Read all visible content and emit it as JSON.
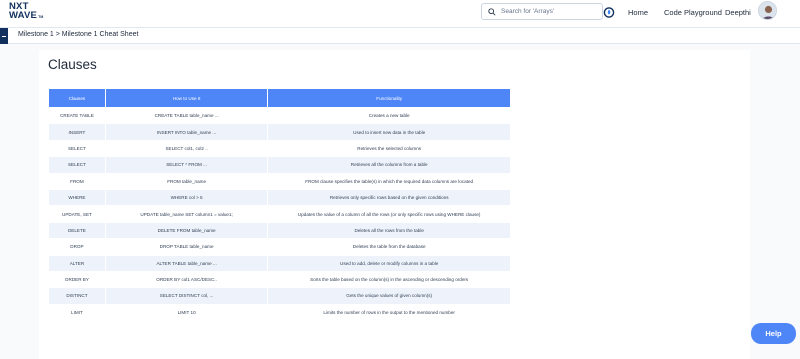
{
  "header": {
    "logo_line1": "NXT",
    "logo_line2": "WAVE",
    "logo_tm": "TM",
    "search_placeholder": "Search for 'Arrays'",
    "nav": {
      "home": "Home",
      "code_playground": "Code Playground",
      "user": "Deepthi"
    }
  },
  "breadcrumb": "Milestone 1 > Milestone 1 Cheat Sheet",
  "section_title": "Clauses",
  "table": {
    "headers": [
      "Clauses",
      "How to Use It",
      "Functionality"
    ],
    "rows": [
      [
        "CREATE TABLE",
        "CREATE TABLE table_name ...",
        "Creates a new table"
      ],
      [
        "INSERT",
        "INSERT INTO table_name ...",
        "Used to insert new data in the table"
      ],
      [
        "SELECT",
        "SELECT col1, col2 ..",
        "Retrieves the selected columns"
      ],
      [
        "SELECT",
        "SELECT * FROM ...",
        "Retrieves all the columns from a table"
      ],
      [
        "FROM",
        "FROM table_name",
        "FROM clause specifies the table(s) in which the required data columns are located"
      ],
      [
        "WHERE",
        "WHERE col > 5",
        "Retrieves only specific rows based on the given conditions"
      ],
      [
        "UPDATE, SET",
        "UPDATE table_name SET column1 = value1;",
        "Updates the value of a column of all the rows (or only specific rows using WHERE clause)"
      ],
      [
        "DELETE",
        "DELETE FROM table_name",
        "Deletes all the rows from the table"
      ],
      [
        "DROP",
        "DROP TABLE table_name",
        "Deletes the table from the database"
      ],
      [
        "ALTER",
        "ALTER TABLE table_name ...",
        "Used to add, delete or modify columns in a table"
      ],
      [
        "ORDER BY",
        "ORDER BY col1 ASC/DESC..",
        "Sorts the table based on the column(s) in the ascending or descending orders"
      ],
      [
        "DISTINCT",
        "SELECT DISTINCT col, ...",
        "Gets the unique values of given column(s)"
      ],
      [
        "LIMIT",
        "LIMIT 10",
        "Limits the number of rows in the output to the mentioned number"
      ]
    ]
  },
  "help_button": "Help",
  "icons": {
    "search": "search-icon",
    "streak": "streak-icon",
    "back": "back-arrow-icon",
    "avatar": "user-avatar"
  },
  "colors": {
    "brand_navy": "#12305e",
    "table_header": "#4f86f7",
    "help_button": "#4f86f7",
    "row_alt": "#eef3fb"
  }
}
